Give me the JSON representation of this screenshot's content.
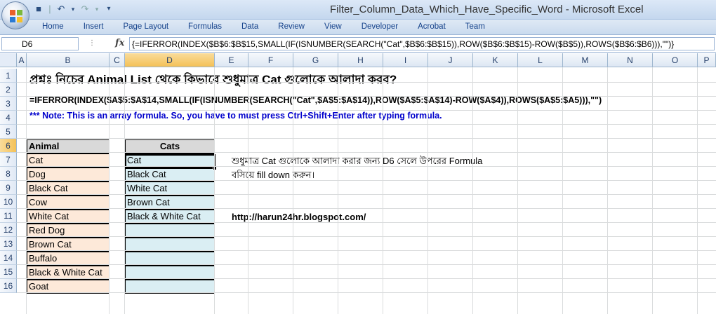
{
  "window": {
    "title": "Filter_Column_Data_Which_Have_Specific_Word - Microsoft Excel"
  },
  "quick_access": {
    "separator": "|",
    "undo_icon": "↶",
    "redo_icon": "↷",
    "dropdown_icon": "▾"
  },
  "ribbon": {
    "tabs": [
      "Home",
      "Insert",
      "Page Layout",
      "Formulas",
      "Data",
      "Review",
      "View",
      "Developer",
      "Acrobat",
      "Team"
    ]
  },
  "formula_bar": {
    "name_box": "D6",
    "fx_label": "fx",
    "formula": "{=IFERROR(INDEX($B$6:$B$15,SMALL(IF(ISNUMBER(SEARCH(\"Cat\",$B$6:$B$15)),ROW($B$6:$B$15)-ROW($B$5)),ROWS($B$6:$B6))),\"\")}"
  },
  "columns": [
    "A",
    "B",
    "C",
    "D",
    "E",
    "F",
    "G",
    "H",
    "I",
    "J",
    "K",
    "L",
    "M",
    "N",
    "O",
    "P"
  ],
  "rows": [
    "1",
    "2",
    "3",
    "4",
    "5",
    "6",
    "7",
    "8",
    "9",
    "10",
    "11",
    "12",
    "13",
    "14",
    "15",
    "16"
  ],
  "sheet": {
    "question": "প্রশ্নঃ নিচের Animal List থেকে কিভাবে শুধুমাত্র Cat গুলোকে আলাদা করব?",
    "formula_text": "=IFERROR(INDEX($A$5:$A$14,SMALL(IF(ISNUMBER(SEARCH(\"Cat\",$A$5:$A$14)),ROW($A$5:$A$14)-ROW($A$4)),ROWS($A$5:$A5))),\"\")",
    "note": "*** Note: This is an array formula. So, you have to must press Ctrl+Shift+Enter after typing formula.",
    "animal_header": "Animal",
    "animals": [
      "Cat",
      "Dog",
      "Black Cat",
      "Cow",
      "White Cat",
      "Red Dog",
      "Brown Cat",
      "Buffalo",
      "Black & White Cat",
      "Goat"
    ],
    "cats_header": "Cats",
    "cats": [
      "Cat",
      "Black Cat",
      "White Cat",
      "Brown Cat",
      "Black & White Cat",
      "",
      "",
      "",
      "",
      ""
    ],
    "instruction_line1": "শুধুমাত্র Cat গুলোকে আলাদা করার জন্য D6 সেলে উপরের Formula",
    "instruction_line2": "বসিয়ে fill down করুন।",
    "url": "http://harun24hr.blogspot.com/"
  },
  "colors": {
    "animal_fill": "#fde9d9",
    "cats_fill": "#daeef3",
    "header_fill": "#d9d9d9",
    "note_color": "#0000cc"
  }
}
